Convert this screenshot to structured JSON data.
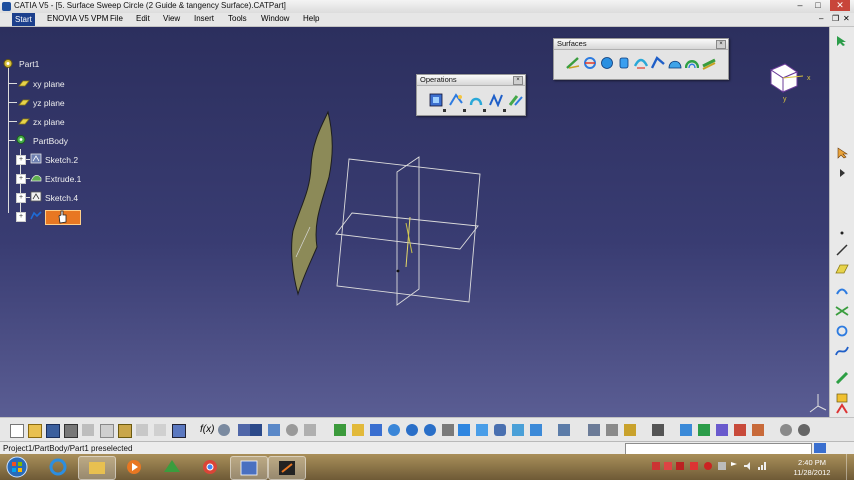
{
  "window": {
    "title": "CATIA V5 - [5. Surface Sweep Circle (2 Guide & tangency Surface).CATPart]",
    "controls": [
      "–",
      "□",
      "✕"
    ]
  },
  "menu": {
    "items": [
      "Start",
      "ENOVIA V5 VPM",
      "File",
      "Edit",
      "View",
      "Insert",
      "Tools",
      "Window",
      "Help"
    ]
  },
  "tree": {
    "root": "Part1",
    "planes": [
      "xy plane",
      "yz plane",
      "zx plane"
    ],
    "body": "PartBody",
    "features": [
      "Sketch.2",
      "Extrude.1",
      "Sketch.4"
    ]
  },
  "toolbars": {
    "surfaces": {
      "title": "Surfaces",
      "close": "×",
      "icons": [
        "extrude-surface-icon",
        "revolve-surface-icon",
        "sphere-icon",
        "cylinder-icon",
        "offset-surface-icon",
        "sweep-surface-icon",
        "fill-surface-icon",
        "multi-section-surface-icon",
        "blend-surface-icon"
      ]
    },
    "operations": {
      "title": "Operations",
      "close": "×",
      "icons": [
        "join-icon",
        "split-icon",
        "fillet-icon",
        "transform-icon",
        "extrapolate-icon"
      ]
    }
  },
  "compass": {
    "x_label": "x",
    "y_label": "y"
  },
  "status": {
    "text": "Project1/PartBody/Part1 preselected"
  },
  "clock": {
    "time": "2:40 PM",
    "date": "11/28/2012"
  },
  "colors": {
    "viewport_top": "#2c2f5e",
    "viewport_bottom": "#5a5d93",
    "surface_fill": "#8c8a58",
    "highlight": "#e87722"
  }
}
